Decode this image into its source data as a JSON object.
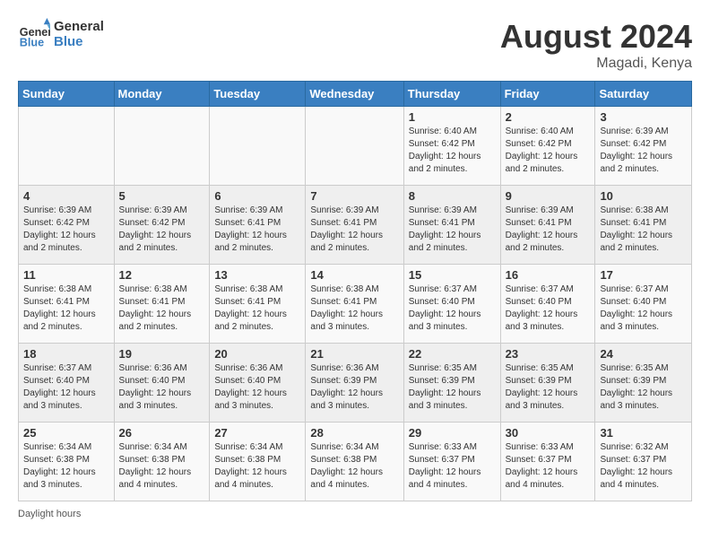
{
  "header": {
    "logo_line1": "General",
    "logo_line2": "Blue",
    "month_title": "August 2024",
    "location": "Magadi, Kenya"
  },
  "footer": {
    "daylight_label": "Daylight hours"
  },
  "days_of_week": [
    "Sunday",
    "Monday",
    "Tuesday",
    "Wednesday",
    "Thursday",
    "Friday",
    "Saturday"
  ],
  "weeks": [
    [
      {
        "day": "",
        "info": ""
      },
      {
        "day": "",
        "info": ""
      },
      {
        "day": "",
        "info": ""
      },
      {
        "day": "",
        "info": ""
      },
      {
        "day": "1",
        "info": "Sunrise: 6:40 AM\nSunset: 6:42 PM\nDaylight: 12 hours and 2 minutes."
      },
      {
        "day": "2",
        "info": "Sunrise: 6:40 AM\nSunset: 6:42 PM\nDaylight: 12 hours and 2 minutes."
      },
      {
        "day": "3",
        "info": "Sunrise: 6:39 AM\nSunset: 6:42 PM\nDaylight: 12 hours and 2 minutes."
      }
    ],
    [
      {
        "day": "4",
        "info": "Sunrise: 6:39 AM\nSunset: 6:42 PM\nDaylight: 12 hours and 2 minutes."
      },
      {
        "day": "5",
        "info": "Sunrise: 6:39 AM\nSunset: 6:42 PM\nDaylight: 12 hours and 2 minutes."
      },
      {
        "day": "6",
        "info": "Sunrise: 6:39 AM\nSunset: 6:41 PM\nDaylight: 12 hours and 2 minutes."
      },
      {
        "day": "7",
        "info": "Sunrise: 6:39 AM\nSunset: 6:41 PM\nDaylight: 12 hours and 2 minutes."
      },
      {
        "day": "8",
        "info": "Sunrise: 6:39 AM\nSunset: 6:41 PM\nDaylight: 12 hours and 2 minutes."
      },
      {
        "day": "9",
        "info": "Sunrise: 6:39 AM\nSunset: 6:41 PM\nDaylight: 12 hours and 2 minutes."
      },
      {
        "day": "10",
        "info": "Sunrise: 6:38 AM\nSunset: 6:41 PM\nDaylight: 12 hours and 2 minutes."
      }
    ],
    [
      {
        "day": "11",
        "info": "Sunrise: 6:38 AM\nSunset: 6:41 PM\nDaylight: 12 hours and 2 minutes."
      },
      {
        "day": "12",
        "info": "Sunrise: 6:38 AM\nSunset: 6:41 PM\nDaylight: 12 hours and 2 minutes."
      },
      {
        "day": "13",
        "info": "Sunrise: 6:38 AM\nSunset: 6:41 PM\nDaylight: 12 hours and 2 minutes."
      },
      {
        "day": "14",
        "info": "Sunrise: 6:38 AM\nSunset: 6:41 PM\nDaylight: 12 hours and 3 minutes."
      },
      {
        "day": "15",
        "info": "Sunrise: 6:37 AM\nSunset: 6:40 PM\nDaylight: 12 hours and 3 minutes."
      },
      {
        "day": "16",
        "info": "Sunrise: 6:37 AM\nSunset: 6:40 PM\nDaylight: 12 hours and 3 minutes."
      },
      {
        "day": "17",
        "info": "Sunrise: 6:37 AM\nSunset: 6:40 PM\nDaylight: 12 hours and 3 minutes."
      }
    ],
    [
      {
        "day": "18",
        "info": "Sunrise: 6:37 AM\nSunset: 6:40 PM\nDaylight: 12 hours and 3 minutes."
      },
      {
        "day": "19",
        "info": "Sunrise: 6:36 AM\nSunset: 6:40 PM\nDaylight: 12 hours and 3 minutes."
      },
      {
        "day": "20",
        "info": "Sunrise: 6:36 AM\nSunset: 6:40 PM\nDaylight: 12 hours and 3 minutes."
      },
      {
        "day": "21",
        "info": "Sunrise: 6:36 AM\nSunset: 6:39 PM\nDaylight: 12 hours and 3 minutes."
      },
      {
        "day": "22",
        "info": "Sunrise: 6:35 AM\nSunset: 6:39 PM\nDaylight: 12 hours and 3 minutes."
      },
      {
        "day": "23",
        "info": "Sunrise: 6:35 AM\nSunset: 6:39 PM\nDaylight: 12 hours and 3 minutes."
      },
      {
        "day": "24",
        "info": "Sunrise: 6:35 AM\nSunset: 6:39 PM\nDaylight: 12 hours and 3 minutes."
      }
    ],
    [
      {
        "day": "25",
        "info": "Sunrise: 6:34 AM\nSunset: 6:38 PM\nDaylight: 12 hours and 3 minutes."
      },
      {
        "day": "26",
        "info": "Sunrise: 6:34 AM\nSunset: 6:38 PM\nDaylight: 12 hours and 4 minutes."
      },
      {
        "day": "27",
        "info": "Sunrise: 6:34 AM\nSunset: 6:38 PM\nDaylight: 12 hours and 4 minutes."
      },
      {
        "day": "28",
        "info": "Sunrise: 6:34 AM\nSunset: 6:38 PM\nDaylight: 12 hours and 4 minutes."
      },
      {
        "day": "29",
        "info": "Sunrise: 6:33 AM\nSunset: 6:37 PM\nDaylight: 12 hours and 4 minutes."
      },
      {
        "day": "30",
        "info": "Sunrise: 6:33 AM\nSunset: 6:37 PM\nDaylight: 12 hours and 4 minutes."
      },
      {
        "day": "31",
        "info": "Sunrise: 6:32 AM\nSunset: 6:37 PM\nDaylight: 12 hours and 4 minutes."
      }
    ]
  ]
}
